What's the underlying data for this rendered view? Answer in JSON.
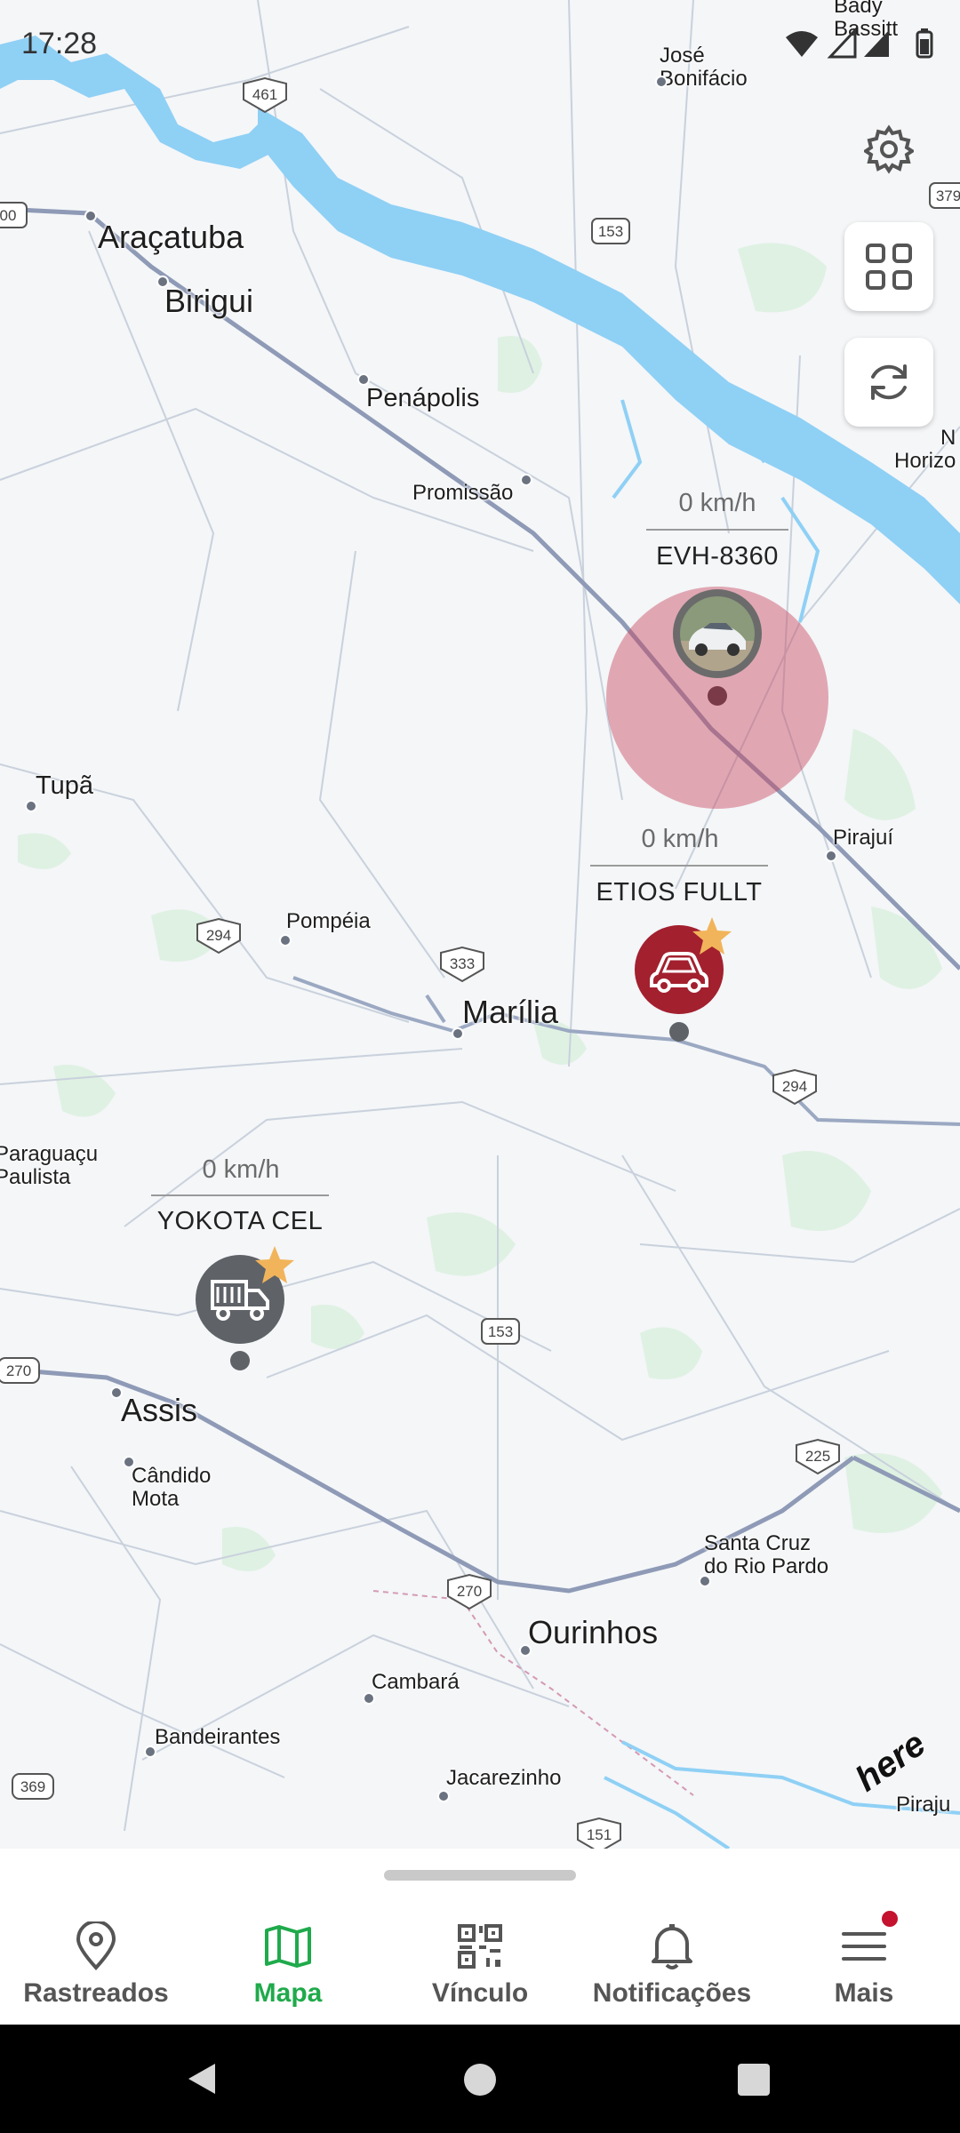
{
  "status_bar": {
    "time": "17:28"
  },
  "map": {
    "cities": [
      {
        "name": "Araçatuba",
        "size": "big"
      },
      {
        "name": "Birigui",
        "size": "big"
      },
      {
        "name": "Penápolis",
        "size": "med"
      },
      {
        "name": "Promissão",
        "size": "sm"
      },
      {
        "name": "José\nBonifácio",
        "size": "sm"
      },
      {
        "name": "Tupã",
        "size": "med"
      },
      {
        "name": "Pompéia",
        "size": "sm"
      },
      {
        "name": "Marília",
        "size": "big"
      },
      {
        "name": "Pirajuí",
        "size": "sm"
      },
      {
        "name": "Paraguaçu\nPaulista",
        "size": "sm"
      },
      {
        "name": "Assis",
        "size": "big"
      },
      {
        "name": "Cândido\nMota",
        "size": "sm"
      },
      {
        "name": "Santa Cruz\ndo Rio Pardo",
        "size": "sm"
      },
      {
        "name": "Ourinhos",
        "size": "big"
      },
      {
        "name": "Cambará",
        "size": "sm"
      },
      {
        "name": "Bandeirantes",
        "size": "sm"
      },
      {
        "name": "Jacarezinho",
        "size": "sm"
      },
      {
        "name": "Bady\nBassitt",
        "size": "sm"
      },
      {
        "name": "N\nHorizo",
        "size": "sm"
      },
      {
        "name": "Piraju",
        "size": "sm"
      }
    ],
    "road_shields": [
      "461",
      "153",
      "379",
      "00",
      "294",
      "333",
      "294",
      "153",
      "270",
      "225",
      "270",
      "369",
      "151"
    ],
    "attribution": "here"
  },
  "vehicles": [
    {
      "name": "EVH-8360",
      "speed": "0 km/h",
      "color": "#d98e9c",
      "icon": "car-photo-icon"
    },
    {
      "name": "ETIOS FULLT",
      "speed": "0 km/h",
      "color": "#a3202f",
      "icon": "car-icon",
      "favorite": true
    },
    {
      "name": "YOKOTA CEL",
      "speed": "0 km/h",
      "color": "#5f6368",
      "icon": "truck-icon",
      "favorite": true
    }
  ],
  "fabs": [
    {
      "icon": "gear-icon"
    },
    {
      "icon": "grid-icon"
    },
    {
      "icon": "refresh-icon"
    }
  ],
  "bottom_nav": {
    "items": [
      {
        "label": "Rastreados",
        "icon": "location-pin-icon"
      },
      {
        "label": "Mapa",
        "icon": "map-icon",
        "active": true
      },
      {
        "label": "Vínculo",
        "icon": "qr-code-icon"
      },
      {
        "label": "Notificações",
        "icon": "bell-icon"
      },
      {
        "label": "Mais",
        "icon": "menu-icon",
        "badge": true
      }
    ],
    "active_color": "#1faa4b",
    "badge_color": "#c4122f"
  }
}
